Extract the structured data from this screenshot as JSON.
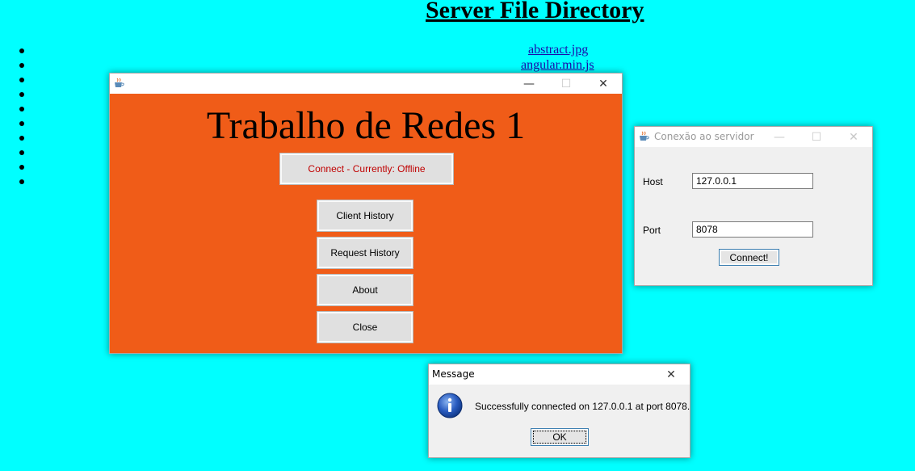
{
  "page": {
    "heading": "Server File Directory",
    "files": [
      "abstract.jpg",
      "angular.min.js"
    ],
    "bullet_count": 10
  },
  "main_window": {
    "title": "",
    "heading": "Trabalho de Redes 1",
    "connect_label": "Connect - Currently: Offline",
    "buttons": [
      "Client History",
      "Request History",
      "About",
      "Close"
    ],
    "background_color": "#f05c18"
  },
  "conn_dialog": {
    "title": "Conexão ao servidor",
    "host_label": "Host",
    "host_value": "127.0.0.1",
    "port_label": "Port",
    "port_value": "8078",
    "connect_button": "Connect!"
  },
  "message_dialog": {
    "title": "Message",
    "text": "Successfully connected on 127.0.0.1 at port 8078.",
    "ok_label": "OK"
  },
  "window_controls": {
    "minimize": "—",
    "maximize": "☐",
    "close": "✕"
  },
  "icons": {
    "app": "java-coffee-icon",
    "info": "info-icon"
  }
}
